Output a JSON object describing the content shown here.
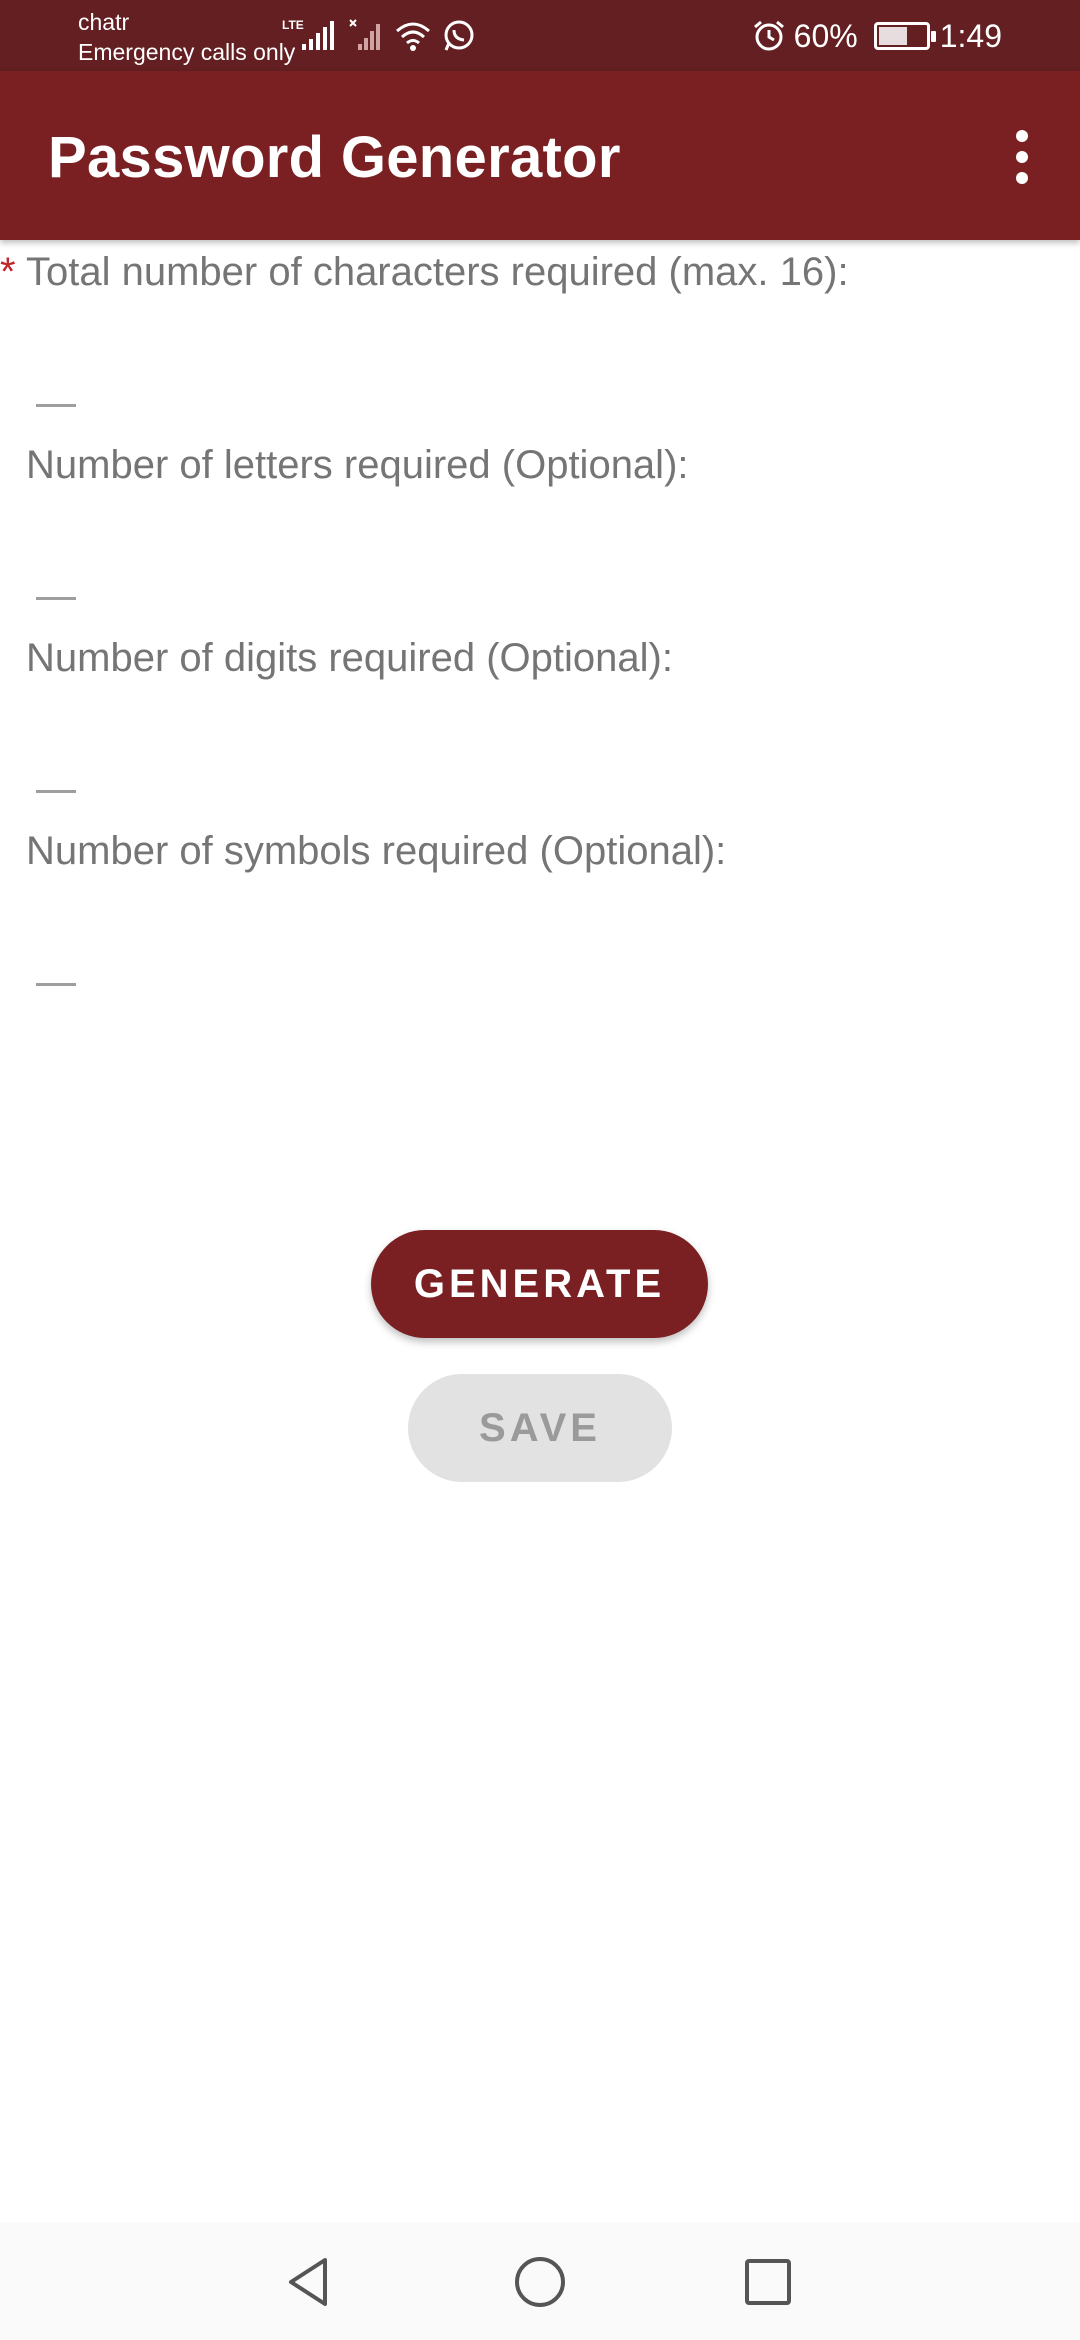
{
  "status_bar": {
    "carrier": "chatr",
    "emergency": "Emergency calls only",
    "network_type": "LTE",
    "battery_percent": "60%",
    "battery_level": 0.6,
    "time": "1:49",
    "icons": [
      "signal-icon",
      "signal-none-icon",
      "wifi-icon",
      "whatsapp-icon",
      "alarm-icon",
      "battery-icon"
    ]
  },
  "app_bar": {
    "title": "Password Generator",
    "menu_icon": "more-vert-icon",
    "color": "#7a2022"
  },
  "form": {
    "required_marker": "*",
    "fields": [
      {
        "label": "Total number of characters required (max. 16):",
        "value": "",
        "required": true
      },
      {
        "label": "Number of letters required (Optional):",
        "value": "",
        "required": false
      },
      {
        "label": "Number of digits required (Optional):",
        "value": "",
        "required": false
      },
      {
        "label": "Number of symbols required (Optional):",
        "value": "",
        "required": false
      }
    ]
  },
  "buttons": {
    "generate_label": "GENERATE",
    "save_label": "SAVE"
  },
  "nav_bar": {
    "icons": [
      "back-icon",
      "home-icon",
      "recents-icon"
    ]
  },
  "colors": {
    "status_bar": "#631f21",
    "primary": "#7a2022",
    "label_text": "#757575",
    "required_star": "#c0272d",
    "disabled_button": "#e2e2e2"
  }
}
